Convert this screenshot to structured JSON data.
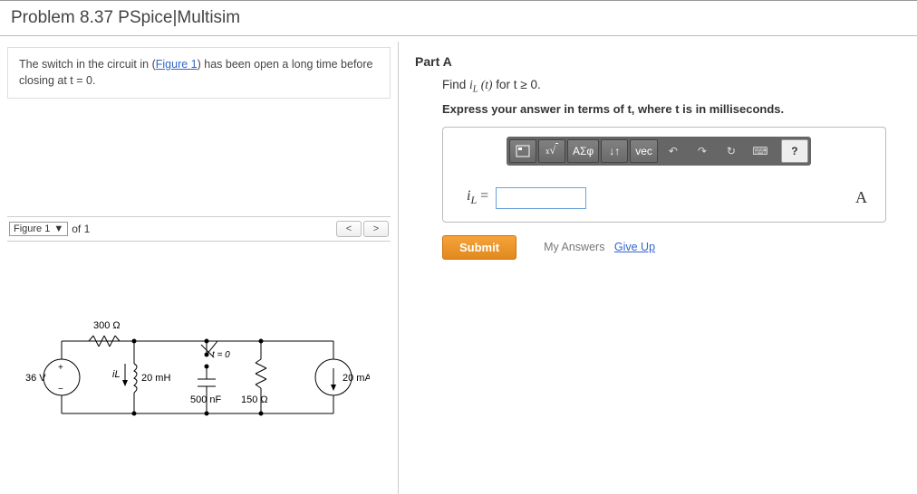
{
  "title": "Problem 8.37 PSpice|Multisim",
  "intro": {
    "pre": "The switch in the circuit in (",
    "link": "Figure 1",
    "post": ") has been open a long time before closing at t = 0."
  },
  "figure": {
    "label": "Figure 1",
    "of": "of 1",
    "prev": "<",
    "next": ">"
  },
  "circuit": {
    "vsrc": "36 V",
    "r1": "300 Ω",
    "iL": "iL",
    "L": "20 mH",
    "switch_t": "t = 0",
    "C": "500 nF",
    "r2": "150 Ω",
    "isrc": "20 mA"
  },
  "partA": {
    "heading": "Part A",
    "prompt_pre": "Find ",
    "prompt_var": "iL (t)",
    "prompt_post": " for t ≥ 0.",
    "instr": "Express your answer in terms of t, where t is in milliseconds.",
    "toolbar": {
      "templates_alt": "templates",
      "sqrt_alt": "x√",
      "greek": "ΑΣφ",
      "subsup": "↓↑",
      "vec": "vec",
      "undo": "↶",
      "redo": "↷",
      "reset": "↻",
      "keyboard": "⌨",
      "help": "?"
    },
    "eq_label_html": "i<span class='sub'>L</span> =",
    "eq_value": "",
    "unit": "A",
    "submit": "Submit",
    "myanswers": "My Answers",
    "giveup": "Give Up"
  }
}
